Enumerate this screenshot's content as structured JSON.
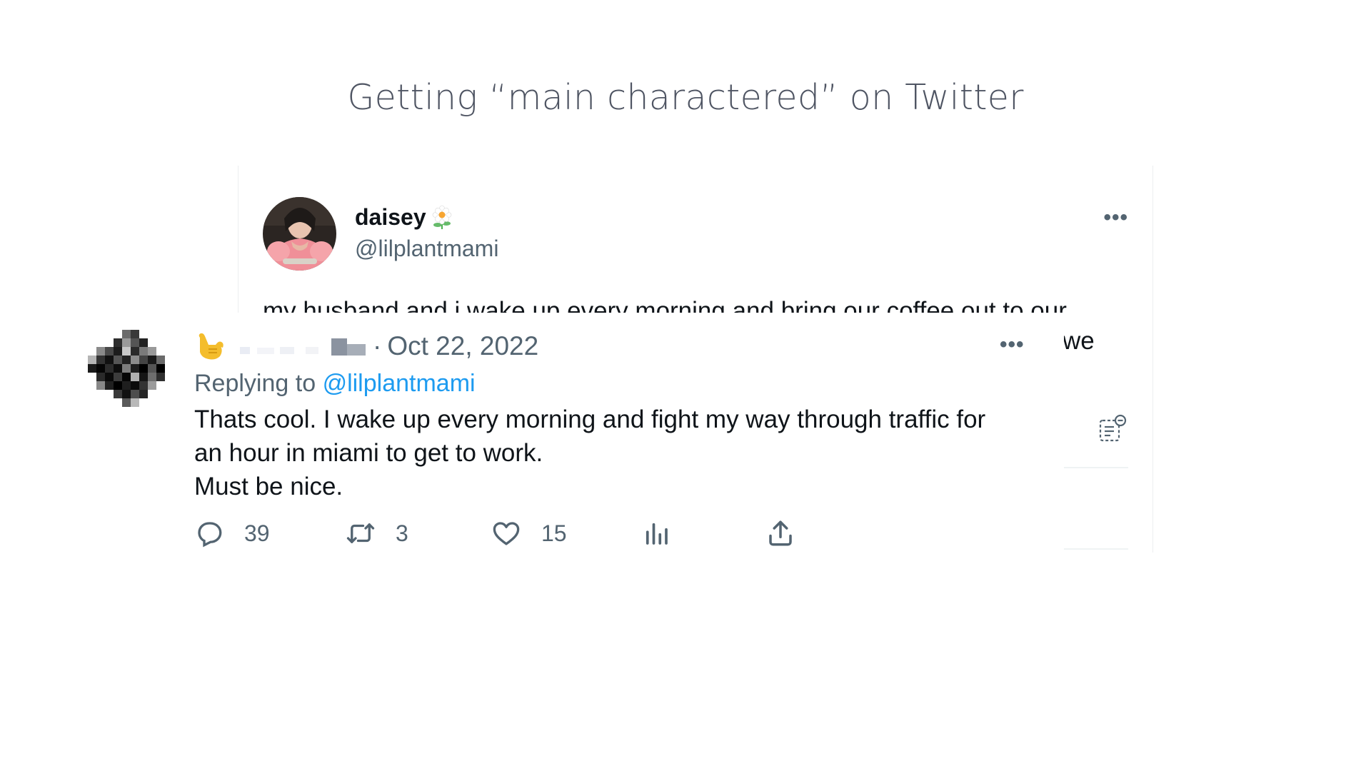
{
  "slide": {
    "title": "Getting “main charactered” on Twitter"
  },
  "original_tweet": {
    "display_name": "daisey",
    "handle": "@lilplantmami",
    "more_label": "•••",
    "text_line1": "my husband and i wake up every morning and bring our coffee out to our",
    "text_line2_fragment": "we",
    "icons": [
      "flower-icon",
      "avatar-photo",
      "more-icon",
      "grok-analyze-icon"
    ]
  },
  "reply_tweet": {
    "date_separator": "·",
    "date": "Oct 22, 2022",
    "more_label": "•••",
    "replying_prefix": "Replying to",
    "replying_mention": "@lilplantmami",
    "body_lines": [
      "Thats cool. I wake up every morning and fight my way through traffic for",
      "an hour in miami to get to work.",
      "Must be nice."
    ],
    "actions": {
      "replies": "39",
      "retweets": "3",
      "likes": "15"
    },
    "icons": [
      "call-me-hand-icon",
      "pixelated-avatar",
      "reply-icon",
      "retweet-icon",
      "like-icon",
      "views-icon",
      "share-icon"
    ],
    "colors": {
      "mention": "#1d9bf0",
      "secondary_text": "#536471",
      "primary_text": "#0f1419"
    }
  }
}
